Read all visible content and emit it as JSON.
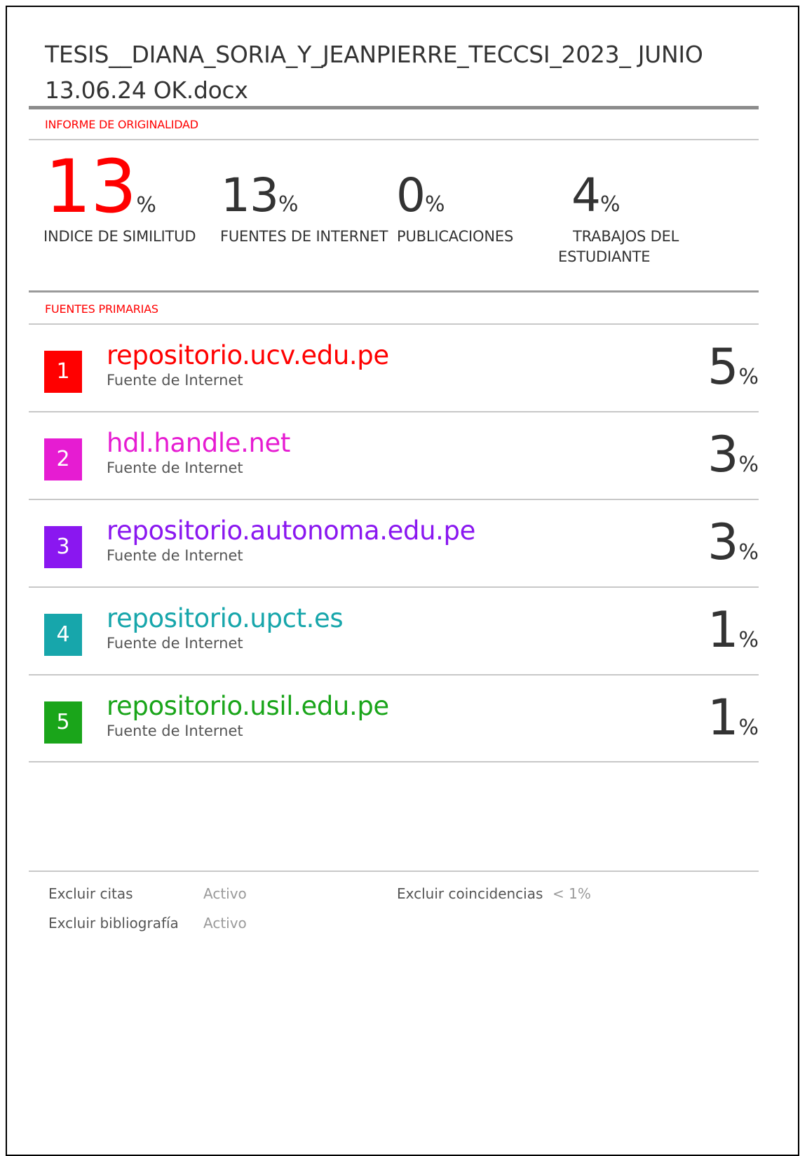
{
  "document": {
    "title_line1": "TESIS__DIANA_SORIA_Y_JEANPIERRE_TECCSI_2023_ JUNIO",
    "title_line2": "13.06.24 OK.docx"
  },
  "originality": {
    "section_label": "INFORME DE ORIGINALIDAD",
    "stats": [
      {
        "value": "13",
        "unit": "%",
        "label_line1": "INDICE DE SIMILITUD",
        "label_line2": ""
      },
      {
        "value": "13",
        "unit": "%",
        "label_line1": "FUENTES DE INTERNET",
        "label_line2": ""
      },
      {
        "value": "0",
        "unit": "%",
        "label_line1": "PUBLICACIONES",
        "label_line2": ""
      },
      {
        "value": "4",
        "unit": "%",
        "label_line1": "TRABAJOS DEL",
        "label_line2": "ESTUDIANTE"
      }
    ]
  },
  "primary_sources": {
    "section_label": "FUENTES PRIMARIAS",
    "items": [
      {
        "rank": "1",
        "name": "repositorio.ucv.edu.pe",
        "type": "Fuente de Internet",
        "percent": "5",
        "unit": "%",
        "color": "#ff0000"
      },
      {
        "rank": "2",
        "name": "hdl.handle.net",
        "type": "Fuente de Internet",
        "percent": "3",
        "unit": "%",
        "color": "#e61cd2"
      },
      {
        "rank": "3",
        "name": "repositorio.autonoma.edu.pe",
        "type": "Fuente de Internet",
        "percent": "3",
        "unit": "%",
        "color": "#8a17f0"
      },
      {
        "rank": "4",
        "name": "repositorio.upct.es",
        "type": "Fuente de Internet",
        "percent": "1",
        "unit": "%",
        "color": "#17a6ab"
      },
      {
        "rank": "5",
        "name": "repositorio.usil.edu.pe",
        "type": "Fuente de Internet",
        "percent": "1",
        "unit": "%",
        "color": "#1aa51a"
      }
    ]
  },
  "filters": {
    "exclude_quotes_label": "Excluir citas",
    "exclude_quotes_value": "Activo",
    "exclude_bibliography_label": "Excluir bibliografía",
    "exclude_bibliography_value": "Activo",
    "exclude_matches_label": "Excluir coincidencias",
    "exclude_matches_value": "< 1%"
  }
}
